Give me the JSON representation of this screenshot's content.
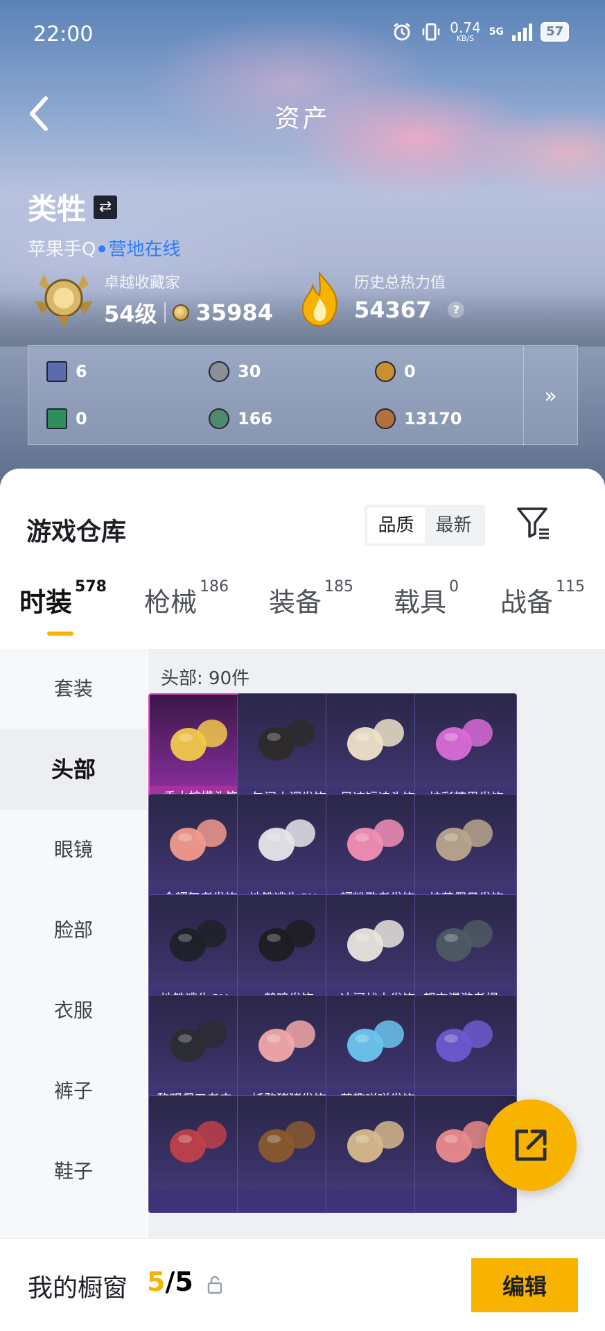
{
  "status_bar": {
    "time": "22:00",
    "net_speed": "0.74",
    "net_unit": "KB/S",
    "network_type": "5G",
    "battery": "57",
    "icons": [
      "alarm-icon",
      "vibrate-icon",
      "signal-icon",
      "battery-icon"
    ]
  },
  "header": {
    "title": "资产"
  },
  "profile": {
    "username": "类牲",
    "platform": "苹果手Q",
    "online_status": "营地在线"
  },
  "stats": {
    "collector_label": "卓越收藏家",
    "collector_level": "54级",
    "collector_points": "35984",
    "heat_label": "历史总热力值",
    "heat_value": "54367",
    "help_icon": "?"
  },
  "currencies": [
    {
      "icon": "card-ticket-icon",
      "value": "6",
      "color": "#5a6cae"
    },
    {
      "icon": "silver-coin-icon",
      "value": "30",
      "color": "#8a8f99"
    },
    {
      "icon": "gold-triangle-coin-icon",
      "value": "0",
      "color": "#c9902f"
    },
    {
      "icon": "green-card-icon",
      "value": "0",
      "color": "#2f8f5a"
    },
    {
      "icon": "green-coin-icon",
      "value": "166",
      "color": "#4f8a6e"
    },
    {
      "icon": "bronze-coin-icon",
      "value": "13170",
      "color": "#b0713a"
    }
  ],
  "more_label": "»",
  "warehouse": {
    "title": "游戏仓库",
    "sort_options": [
      "品质",
      "最新"
    ],
    "active_sort": "品质"
  },
  "tabs": [
    {
      "label": "时装",
      "count": "578",
      "active": true
    },
    {
      "label": "枪械",
      "count": "186"
    },
    {
      "label": "装备",
      "count": "185"
    },
    {
      "label": "载具",
      "count": "0"
    },
    {
      "label": "战备",
      "count": "115"
    }
  ],
  "side_menu": [
    {
      "label": "套装"
    },
    {
      "label": "头部",
      "active": true
    },
    {
      "label": "眼镜"
    },
    {
      "label": "脸部"
    },
    {
      "label": "衣服"
    },
    {
      "label": "裤子"
    },
    {
      "label": "鞋子"
    }
  ],
  "grid": {
    "count_label": "头部: 90件",
    "items": [
      {
        "name": "香水柠檬头饰",
        "featured": true
      },
      {
        "name": "午间小调发饰"
      },
      {
        "name": "风迹短诗头饰"
      },
      {
        "name": "炫彩糖果发饰"
      },
      {
        "name": "金耀舞者发饰"
      },
      {
        "name": "地铁逃生CH..."
      },
      {
        "name": "耀粉歌者发饰"
      },
      {
        "name": "柠萌假日发饰"
      },
      {
        "name": "地铁逃生CH..."
      },
      {
        "name": "鹤鸣发饰"
      },
      {
        "name": "冰河战士发饰"
      },
      {
        "name": "都市漫游者帽..."
      },
      {
        "name": "黎明保卫者皮..."
      },
      {
        "name": "娇憨猪猪发饰"
      },
      {
        "name": "萌趣咩咩发饰"
      },
      {
        "name": ""
      },
      {
        "name": ""
      },
      {
        "name": ""
      },
      {
        "name": ""
      },
      {
        "name": ""
      }
    ]
  },
  "showcase": {
    "label": "我的橱窗",
    "current": "5",
    "separator": "/",
    "total": "5",
    "edit_label": "编辑"
  },
  "colors": {
    "accent": "#f7b300",
    "online": "#2f7cf6",
    "card_border_featured": "#e04cc5",
    "card_bg": "#3a3165"
  }
}
